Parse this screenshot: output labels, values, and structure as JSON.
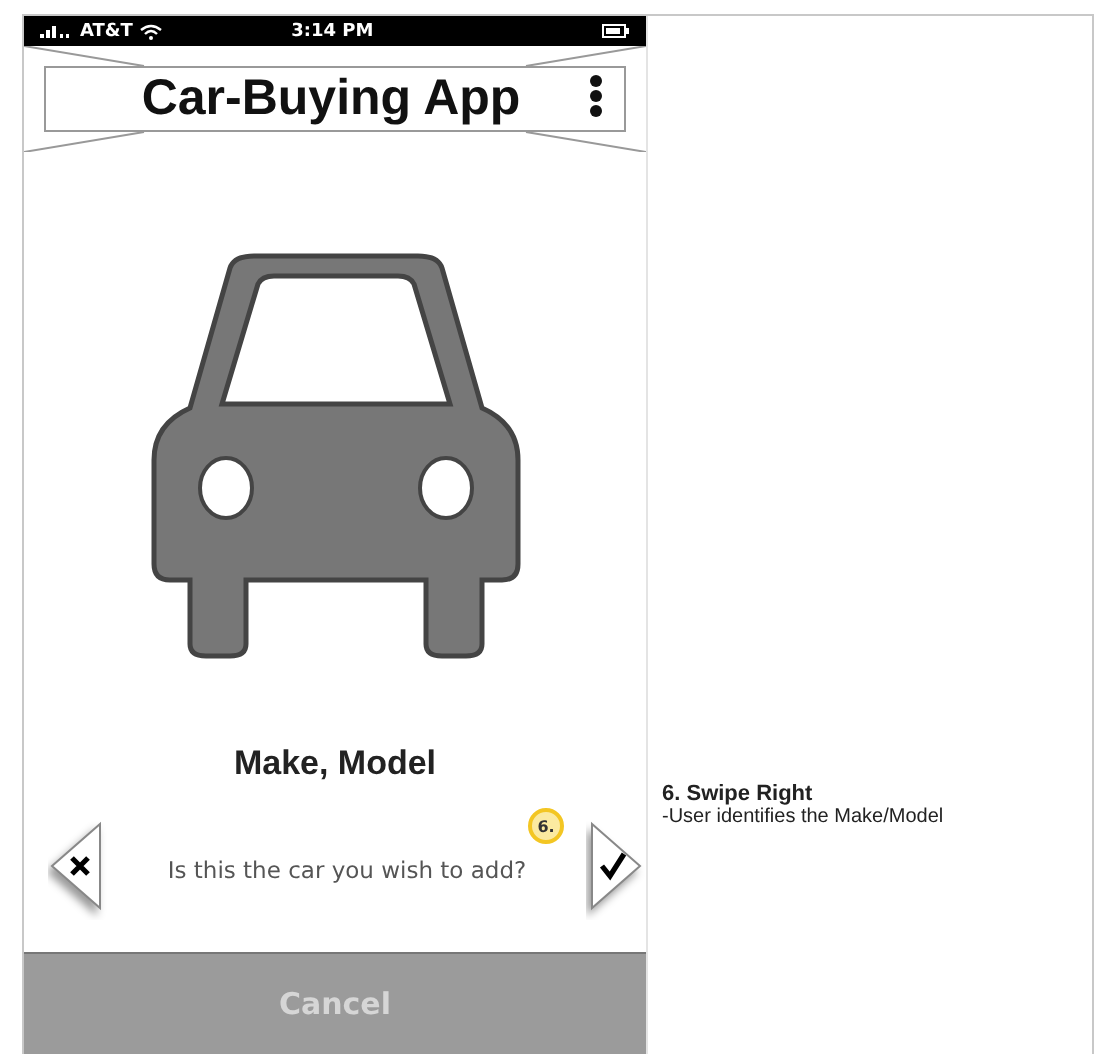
{
  "status_bar": {
    "carrier": "AT&T",
    "time": "3:14 PM"
  },
  "header": {
    "title": "Car-Buying App"
  },
  "car": {
    "name": "Make, Model"
  },
  "prompt": {
    "question": "Is this the car you wish to add?",
    "step_badge": "6."
  },
  "buttons": [
    {
      "label": "Cancel"
    }
  ],
  "annotation": {
    "title": "6. Swipe Right",
    "text": "-User identifies the Make/Model"
  }
}
